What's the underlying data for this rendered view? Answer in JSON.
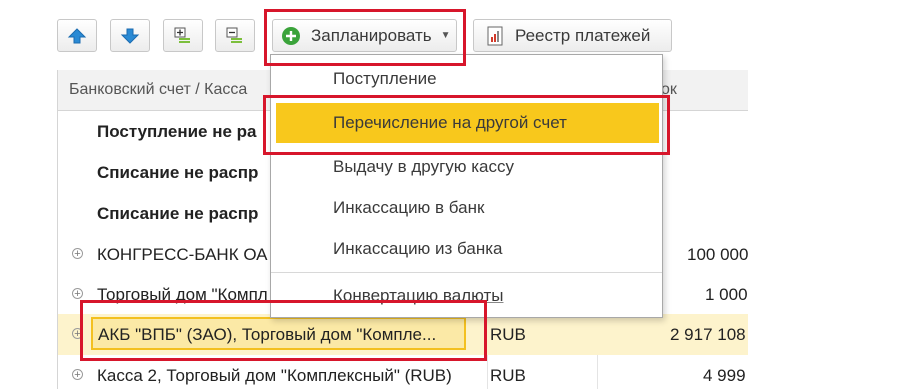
{
  "toolbar": {
    "up_icon": "arrow-up-icon",
    "down_icon": "arrow-down-icon",
    "plan_label": "Запланировать",
    "registry_label": "Реестр платежей"
  },
  "grid": {
    "col_account": "Банковский счет / Касса",
    "col_partial": "ок"
  },
  "rows": [
    {
      "name": "Поступление не ра",
      "bold": true
    },
    {
      "name": "Списание не распр",
      "bold": true
    },
    {
      "name": "Списание не распр",
      "bold": true
    },
    {
      "name": "КОНГРЕСС-БАНК ОА",
      "amount": "100 000"
    },
    {
      "name": "Торговый дом \"Компл",
      "amount": "1 000"
    },
    {
      "name": "АКБ \"ВПБ\" (ЗАО), Торговый дом \"Компле...",
      "currency": "RUB",
      "amount": "2 917 108"
    },
    {
      "name": "Касса 2, Торговый дом \"Комплексный\" (RUB)",
      "currency": "RUB",
      "amount": "4 999"
    }
  ],
  "menu": {
    "items": [
      "Поступление",
      "Перечисление на другой счет",
      "Выдачу в другую кассу",
      "Инкассацию в банк",
      "Инкассацию из банка",
      "Конвертацию валюты"
    ]
  },
  "colors": {
    "highlight": "#f8c81c",
    "selected_row": "#fdf3cc",
    "annotation_red": "#d7162b",
    "arrow_blue": "#2a8ad4",
    "plus_green": "#3aa33a"
  }
}
